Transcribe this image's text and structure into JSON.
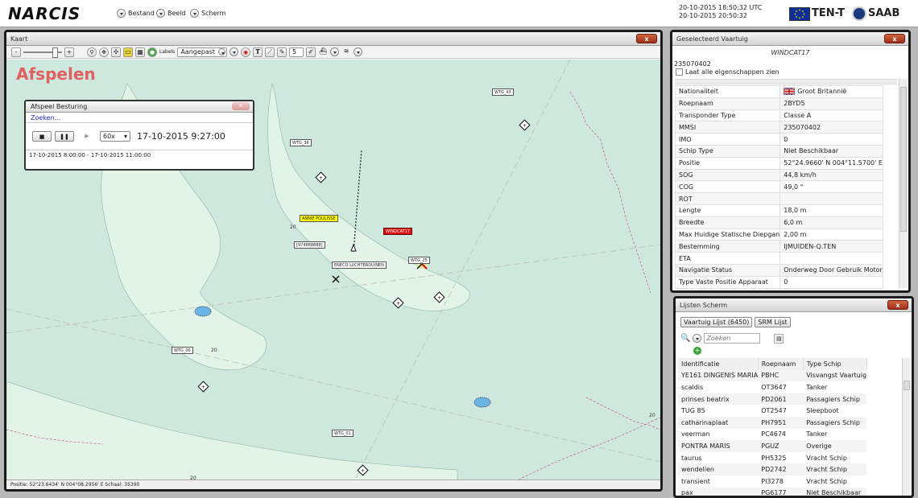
{
  "app": {
    "title": "NARCIS"
  },
  "menu": [
    {
      "label": "Bestand"
    },
    {
      "label": "Beeld"
    },
    {
      "label": "Scherm"
    }
  ],
  "clock": {
    "utc": "20-10-2015 18:50:32 UTC",
    "local": "20-10-2015 20:50:32"
  },
  "brands": {
    "tent": "TEN-T",
    "saab": "SAAB"
  },
  "map": {
    "title": "Kaart",
    "close": "x",
    "mode_label": "Afspelen",
    "toolbar": {
      "labels_prefix": "Labels",
      "labels_select": "Aangepast",
      "spin_value": "5"
    },
    "status": "Positie:  52°23.6434' N 004°08.2956' E   Schaal: 35390",
    "depths": [
      "20",
      "20",
      "20",
      "20"
    ],
    "wind_turbines": [
      {
        "label": "WTG_43"
      },
      {
        "label": "WTG_36"
      },
      {
        "label": "WTG_25"
      },
      {
        "label": "WTG_06"
      },
      {
        "label": "WTG_01"
      }
    ],
    "vessels": [
      {
        "label": "ANNIE POULISSE",
        "color": "#ffff00"
      },
      {
        "label": "WINDCAT17",
        "color": "#e01010"
      },
      {
        "label": "[974888888]",
        "color": "#ffffff"
      },
      {
        "label": "ENECO LUCHTERDUINEN",
        "color": "#ffffff"
      }
    ],
    "colors": {
      "water": "#cfe8de",
      "land_shallow": "#e2f3e8"
    }
  },
  "playback": {
    "title": "Afspeel Besturing",
    "search": "Zoeken...",
    "speed": "60x",
    "current_time": "17-10-2015 9:27:00",
    "range": "17-10-2015 8:00:00 - 17-10-2015 11:00:00"
  },
  "selected_vessel": {
    "title": "Geselecteerd Vaartuig",
    "name": "WINDCAT17",
    "id": "235070402",
    "checkbox_label": "Laat alle eigenschappen zien",
    "properties": [
      {
        "key": "Nationaliteit",
        "value": "Groot Britannië"
      },
      {
        "key": "Roepnaam",
        "value": "2BYD5"
      },
      {
        "key": "Transponder Type",
        "value": "Classe A"
      },
      {
        "key": "MMSI",
        "value": "235070402"
      },
      {
        "key": "IMO",
        "value": "0"
      },
      {
        "key": "Schip Type",
        "value": "Niet Beschikbaar"
      },
      {
        "key": "Positie",
        "value": "52°24.9660' N 004°11.5700' E"
      },
      {
        "key": "SOG",
        "value": "44,8 km/h"
      },
      {
        "key": "COG",
        "value": "49,0 °"
      },
      {
        "key": "ROT",
        "value": ""
      },
      {
        "key": "Lengte",
        "value": "18,0 m"
      },
      {
        "key": "Breedte",
        "value": "6,0 m"
      },
      {
        "key": "Max Huidige Statische Diepgan",
        "value": "2,00 m"
      },
      {
        "key": "Bestemming",
        "value": "IJMUIDEN-Q.TEN"
      },
      {
        "key": "ETA",
        "value": ""
      },
      {
        "key": "Navigatie Status",
        "value": "Onderweg Door Gebruik Motor"
      },
      {
        "key": "Type Vaste Positie Apparaat",
        "value": "0"
      }
    ]
  },
  "lists": {
    "title": "Lijsten Scherm",
    "tabs": [
      {
        "label": "Vaartuig Lijst (6450)"
      },
      {
        "label": "SRM Lijst"
      }
    ],
    "search_placeholder": "Zoeken",
    "columns": [
      "Identificatie",
      "Roepnaam",
      "Type Schip"
    ],
    "rows": [
      [
        "YE161 DINGENIS MARIA",
        "PBHC",
        "Visvangst Vaartuig"
      ],
      [
        "scaldis",
        "OT3647",
        "Tanker"
      ],
      [
        "prinses beatrix",
        "PD2061",
        "Passagiers Schip"
      ],
      [
        "TUG 85",
        "OT2547",
        "Sleepboot"
      ],
      [
        "catharinaplaat",
        "PH7951",
        "Passagiers Schip"
      ],
      [
        "veerman",
        "PC4674",
        "Tanker"
      ],
      [
        "PONTRA MARIS",
        "PGUZ",
        "Overige"
      ],
      [
        "taurus",
        "PH5325",
        "Vracht Schip"
      ],
      [
        "wendelien",
        "PD2742",
        "Vracht Schip"
      ],
      [
        "transient",
        "PI3278",
        "Vracht Schip"
      ],
      [
        "pax",
        "PG6177",
        "Niet Beschikbaar"
      ]
    ]
  }
}
